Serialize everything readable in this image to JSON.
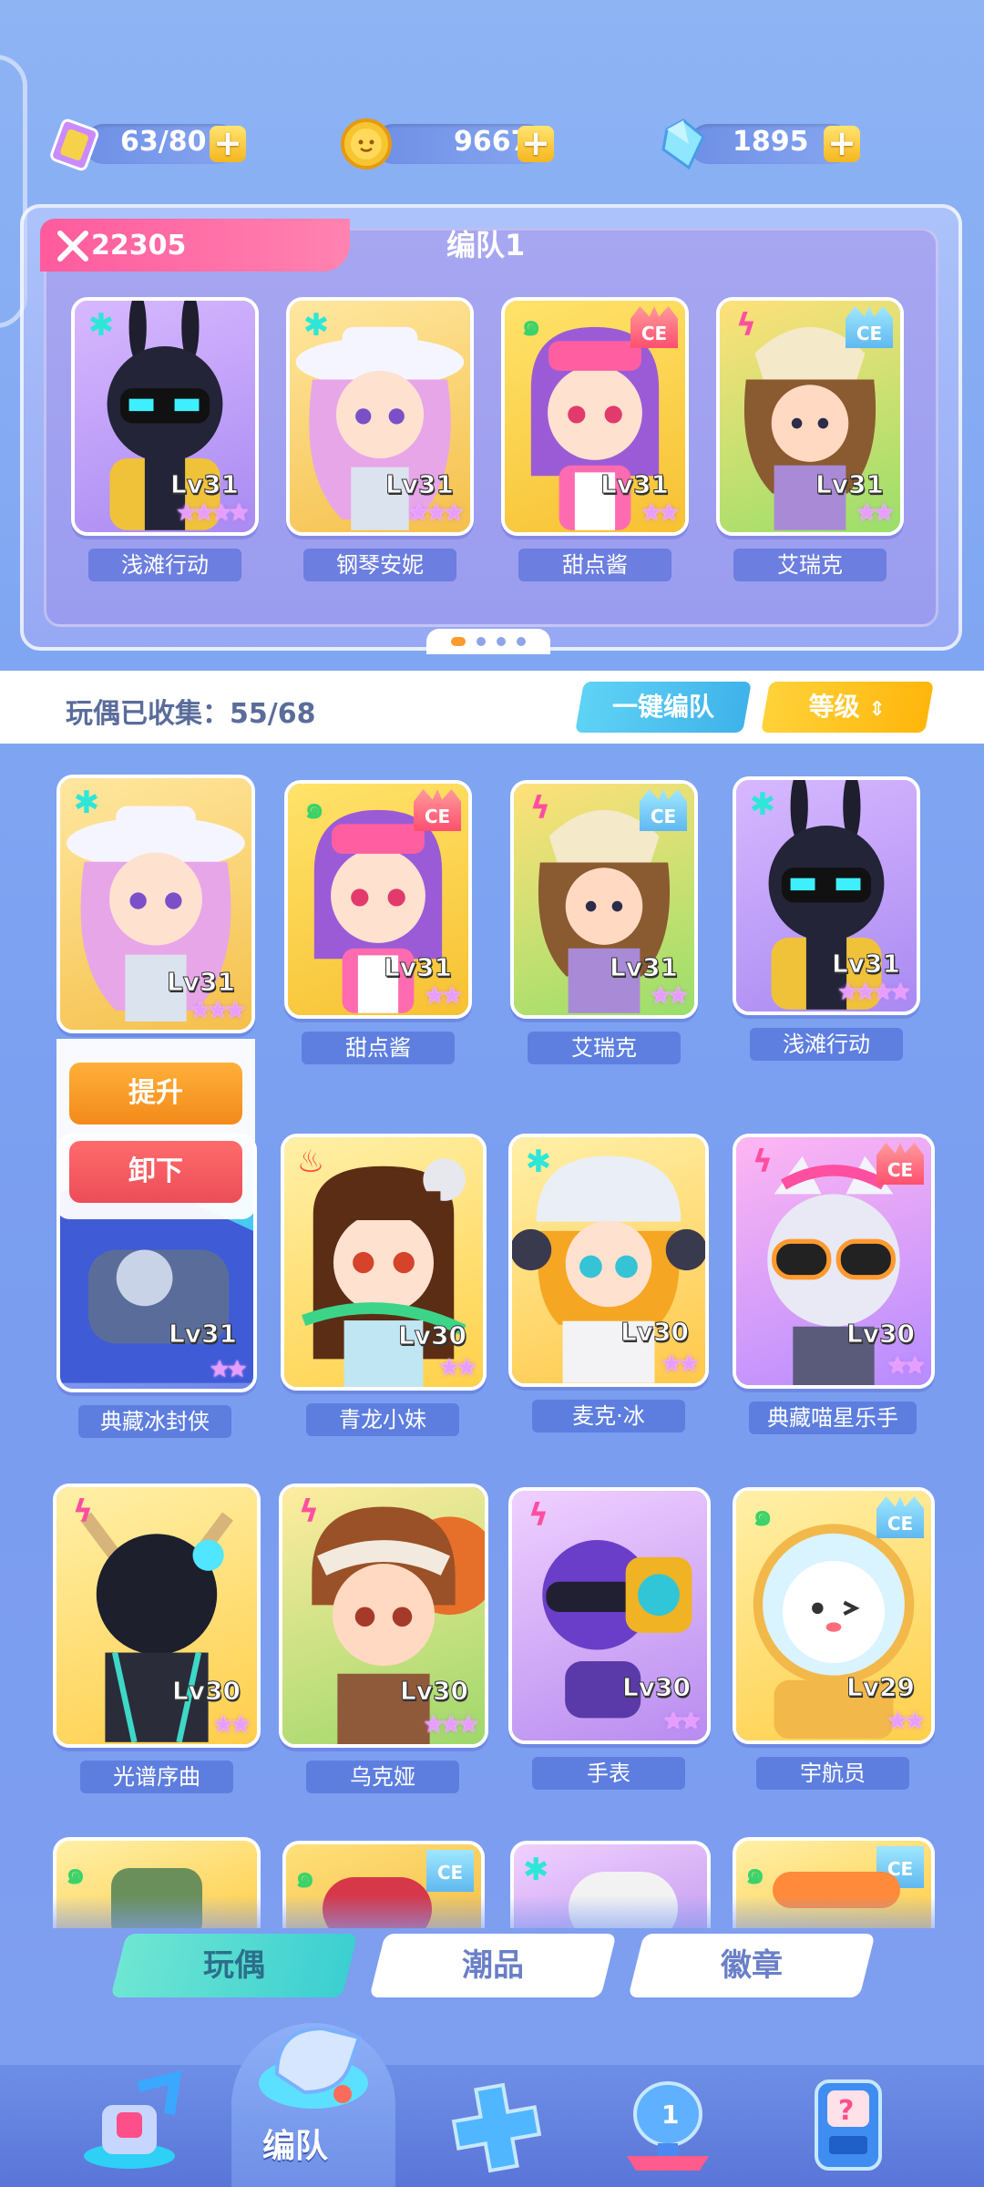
{
  "resources": {
    "tickets": "63/80",
    "coins": "96672",
    "gems": "1895"
  },
  "team": {
    "power": "22305",
    "title": "编队1",
    "members": [
      {
        "name": "浅滩行动",
        "level": "Lv31",
        "stars": "★★★★"
      },
      {
        "name": "钢琴安妮",
        "level": "Lv31",
        "stars": "★★★"
      },
      {
        "name": "甜点酱",
        "level": "Lv31",
        "stars": "★★"
      },
      {
        "name": "艾瑞克",
        "level": "Lv31",
        "stars": "★★"
      }
    ]
  },
  "collection": {
    "label": "玩偶已收集：55/68",
    "auto_team_button": "一键编队",
    "sort_button": "等级"
  },
  "popup": {
    "upgrade": "提升",
    "unload": "卸下"
  },
  "dolls": [
    {
      "name": "",
      "level": "Lv31",
      "stars": "★★★"
    },
    {
      "name": "甜点酱",
      "level": "Lv31",
      "stars": "★★"
    },
    {
      "name": "艾瑞克",
      "level": "Lv31",
      "stars": "★★"
    },
    {
      "name": "浅滩行动",
      "level": "Lv31",
      "stars": "★★★★"
    },
    {
      "name": "典藏冰封侠",
      "level": "Lv31",
      "stars": "★★"
    },
    {
      "name": "青龙小妹",
      "level": "Lv30",
      "stars": "★★"
    },
    {
      "name": "麦克·冰",
      "level": "Lv30",
      "stars": "★★"
    },
    {
      "name": "典藏喵星乐手",
      "level": "Lv30",
      "stars": "★★"
    },
    {
      "name": "光谱序曲",
      "level": "Lv30",
      "stars": "★★"
    },
    {
      "name": "乌克娅",
      "level": "Lv30",
      "stars": "★★★"
    },
    {
      "name": "手表",
      "level": "Lv30",
      "stars": "★★"
    },
    {
      "name": "宇航员",
      "level": "Lv29",
      "stars": "★★"
    }
  ],
  "tabs": [
    "玩偶",
    "潮品",
    "徽章"
  ],
  "nav": {
    "active_label": "编队"
  },
  "colors": {
    "accent_pink": "#ff5b9d",
    "accent_yellow": "#ffb60b",
    "accent_cyan": "#3fb2ea",
    "star_purple": "#e99cff"
  }
}
